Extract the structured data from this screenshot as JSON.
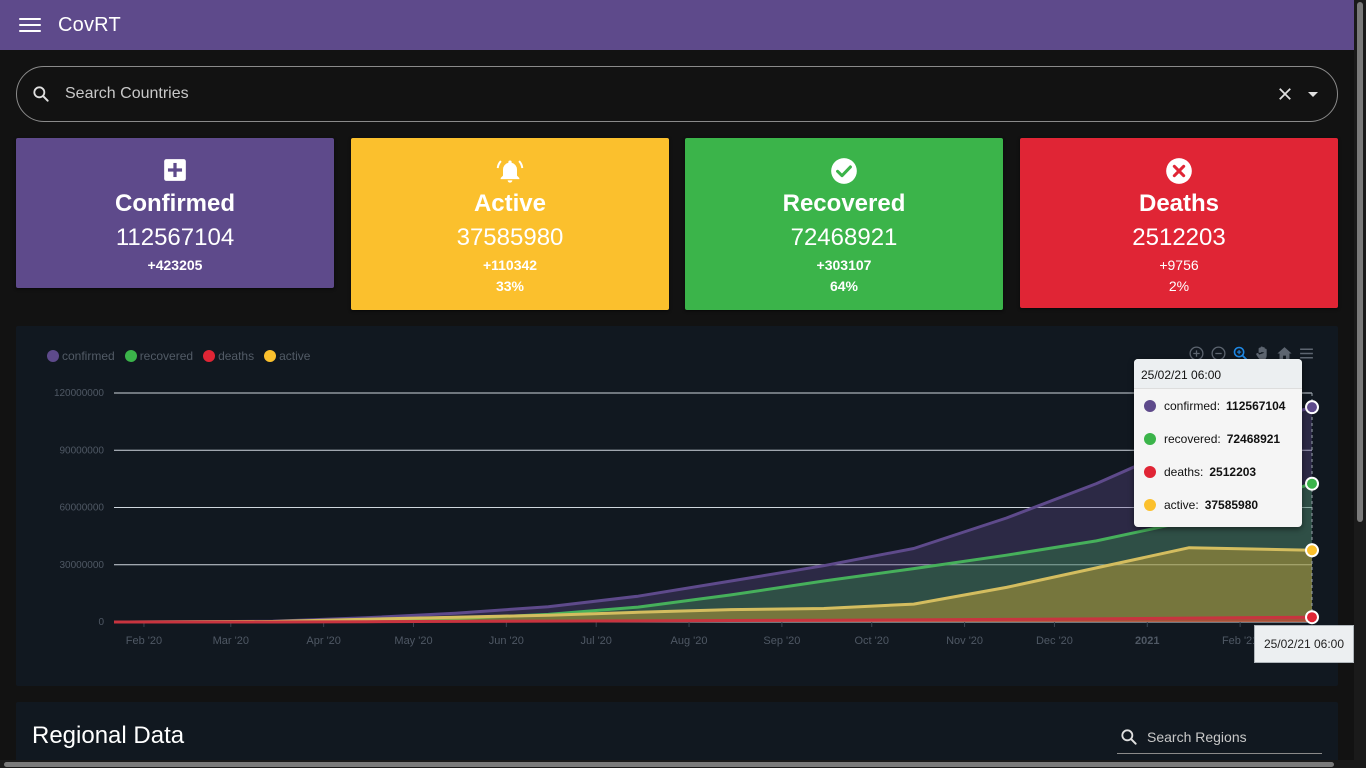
{
  "app": {
    "title": "CovRT"
  },
  "search": {
    "placeholder": "Search Countries"
  },
  "cards": [
    {
      "label": "Confirmed",
      "value": "112567104",
      "delta": "+423205",
      "percent": "",
      "color": "#5e4a8b",
      "icon": "plus-box-icon"
    },
    {
      "label": "Active",
      "value": "37585980",
      "delta": "+110342",
      "percent": "33%",
      "color": "#fbc02d",
      "icon": "bell-icon"
    },
    {
      "label": "Recovered",
      "value": "72468921",
      "delta": "+303107",
      "percent": "64%",
      "color": "#3bb44a",
      "icon": "check-circle-icon"
    },
    {
      "label": "Deaths",
      "value": "2512203",
      "delta": "+9756",
      "percent": "2%",
      "color": "#e02535",
      "icon": "close-circle-icon"
    }
  ],
  "chart_data": {
    "type": "area",
    "title": "",
    "xlabel": "",
    "ylabel": "",
    "ylim": [
      0,
      120000000
    ],
    "y_ticks": [
      "0",
      "30000000",
      "60000000",
      "90000000",
      "120000000"
    ],
    "x_ticks": [
      "Feb '20",
      "Mar '20",
      "Apr '20",
      "May '20",
      "Jun '20",
      "Jul '20",
      "Aug '20",
      "Sep '20",
      "Oct '20",
      "Nov '20",
      "Dec '20",
      "2021",
      "Feb '21"
    ],
    "x": [
      "2020-01-22",
      "2020-02-15",
      "2020-03-15",
      "2020-04-15",
      "2020-05-15",
      "2020-06-15",
      "2020-07-15",
      "2020-08-15",
      "2020-09-15",
      "2020-10-15",
      "2020-11-15",
      "2020-12-15",
      "2021-01-15",
      "2021-02-25"
    ],
    "series": [
      {
        "name": "confirmed",
        "color": "#5e4a8b",
        "values": [
          0,
          100000,
          400000,
          2200000,
          4600000,
          8000000,
          13500000,
          21500000,
          29500000,
          38500000,
          54500000,
          72500000,
          94000000,
          112567104
        ]
      },
      {
        "name": "recovered",
        "color": "#3bb44a",
        "values": [
          0,
          20000,
          100000,
          600000,
          1800000,
          4000000,
          7800000,
          14200000,
          21500000,
          28000000,
          35000000,
          42500000,
          53000000,
          72468921
        ]
      },
      {
        "name": "deaths",
        "color": "#e02535",
        "values": [
          0,
          1000,
          20000,
          150000,
          300000,
          450000,
          600000,
          780000,
          950000,
          1100000,
          1350000,
          1650000,
          2050000,
          2512203
        ]
      },
      {
        "name": "active",
        "color": "#fbc02d",
        "values": [
          0,
          80000,
          280000,
          1450000,
          2500000,
          3550000,
          5100000,
          6520000,
          7050000,
          9400000,
          18150000,
          28350000,
          38950000,
          37585980
        ]
      }
    ],
    "legend": {
      "position": "top-left"
    },
    "grid": true,
    "tooltip": {
      "title": "25/02/21 06:00",
      "rows": [
        {
          "name": "confirmed:",
          "value": "112567104",
          "color": "#5e4a8b"
        },
        {
          "name": "recovered:",
          "value": "72468921",
          "color": "#3bb44a"
        },
        {
          "name": "deaths:",
          "value": "2512203",
          "color": "#e02535"
        },
        {
          "name": "active:",
          "value": "37585980",
          "color": "#fbc02d"
        }
      ]
    },
    "x_crosshair_label": "25/02/21 06:00"
  },
  "toolbar": {
    "icons": [
      "zoom-in-icon",
      "zoom-out-icon",
      "zoom-selection-icon",
      "pan-hand-icon",
      "reset-home-icon",
      "menu-icon"
    ]
  },
  "regional": {
    "title": "Regional Data",
    "search_placeholder": "Search Regions"
  }
}
